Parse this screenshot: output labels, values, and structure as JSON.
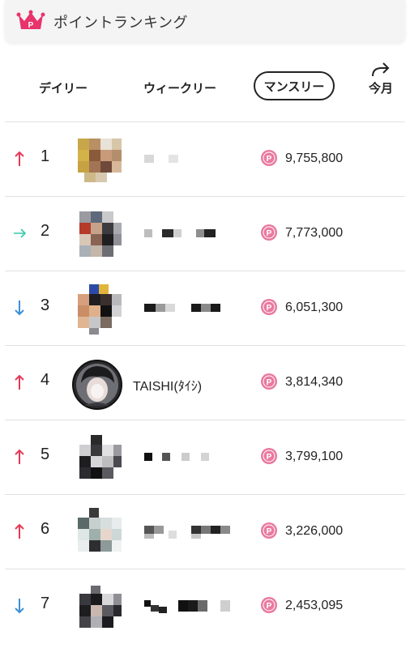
{
  "colors": {
    "accent": "#e8336b",
    "coin": "#e9799f",
    "up": "#e53955",
    "same": "#33c9a9",
    "down": "#3c8fd6"
  },
  "header": {
    "title": "ポイントランキング",
    "icon": "crown-icon"
  },
  "tabs": [
    {
      "label": "デイリー",
      "active": false
    },
    {
      "label": "ウィークリー",
      "active": false
    },
    {
      "label": "マンスリー",
      "active": true
    }
  ],
  "now_button": {
    "label": "今月",
    "icon": "redo-arrow-icon"
  },
  "ranking": [
    {
      "rank": "1",
      "trend": "up",
      "points": "9,755,800",
      "name": ""
    },
    {
      "rank": "2",
      "trend": "same",
      "points": "7,773,000",
      "name": ""
    },
    {
      "rank": "3",
      "trend": "down",
      "points": "6,051,300",
      "name": ""
    },
    {
      "rank": "4",
      "trend": "up",
      "points": "3,814,340",
      "name": "TAISHI(ﾀｲｼ)"
    },
    {
      "rank": "5",
      "trend": "up",
      "points": "3,799,100",
      "name": ""
    },
    {
      "rank": "6",
      "trend": "up",
      "points": "3,226,000",
      "name": ""
    },
    {
      "rank": "7",
      "trend": "down",
      "points": "2,453,095",
      "name": ""
    }
  ]
}
